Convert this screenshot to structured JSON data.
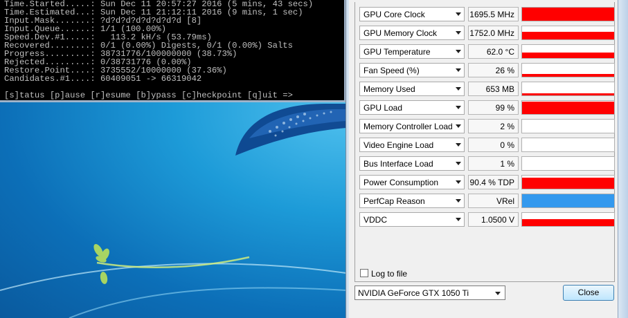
{
  "console": {
    "lines": [
      "Time.Started.....: Sun Dec 11 20:57:27 2016 (5 mins, 43 secs)",
      "Time.Estimated...: Sun Dec 11 21:12:11 2016 (9 mins, 1 sec)",
      "Input.Mask.......: ?d?d?d?d?d?d?d?d [8]",
      "Input.Queue......: 1/1 (100.00%)",
      "Speed.Dev.#1.....:   113.2 kH/s (53.79ms)",
      "Recovered........: 0/1 (0.00%) Digests, 0/1 (0.00%) Salts",
      "Progress.........: 38731776/100000000 (38.73%)",
      "Rejected.........: 0/38731776 (0.00%)",
      "Restore.Point....: 3735552/10000000 (37.36%)",
      "Candidates.#1....: 60409051 -> 66319042"
    ],
    "prompt": "[s]tatus [p]ause [r]esume [b]ypass [c]heckpoint [q]uit =>"
  },
  "gpuz": {
    "colors": {
      "graph_red": "#ff0000",
      "graph_blue": "#3399ee"
    },
    "sensors": [
      {
        "label": "GPU Core Clock",
        "value": "1695.5 MHz",
        "level": 1.0,
        "color": "red"
      },
      {
        "label": "GPU Memory Clock",
        "value": "1752.0 MHz",
        "level": 0.6,
        "color": "red"
      },
      {
        "label": "GPU Temperature",
        "value": "62.0 °C",
        "level": 0.42,
        "color": "red"
      },
      {
        "label": "Fan Speed (%)",
        "value": "26 %",
        "level": 0.2,
        "color": "red"
      },
      {
        "label": "Memory Used",
        "value": "653 MB",
        "level": 0.12,
        "color": "red"
      },
      {
        "label": "GPU Load",
        "value": "99 %",
        "level": 0.95,
        "color": "red"
      },
      {
        "label": "Memory Controller Load",
        "value": "2 %",
        "level": 0.0,
        "color": "red"
      },
      {
        "label": "Video Engine Load",
        "value": "0 %",
        "level": 0.0,
        "color": "red"
      },
      {
        "label": "Bus Interface Load",
        "value": "1 %",
        "level": 0.0,
        "color": "red"
      },
      {
        "label": "Power Consumption",
        "value": "90.4 % TDP",
        "level": 0.85,
        "color": "red"
      },
      {
        "label": "PerfCap Reason",
        "value": "VRel",
        "level": 1.0,
        "color": "blue"
      },
      {
        "label": "VDDC",
        "value": "1.0500 V",
        "level": 0.5,
        "color": "red"
      }
    ],
    "log_to_file": "Log to file",
    "gpu_select": "NVIDIA GeForce GTX 1050 Ti",
    "close_label": "Close"
  }
}
